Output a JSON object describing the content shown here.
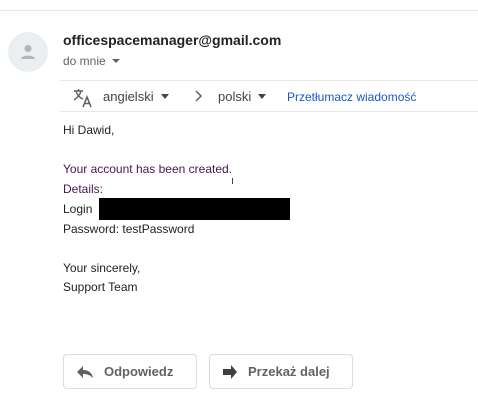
{
  "header": {
    "sender_email": "officespacemanager@gmail.com",
    "recipient_label": "do mnie"
  },
  "translate_bar": {
    "source_language": "angielski",
    "target_language": "polski",
    "translate_link": "Przetłumacz wiadomość"
  },
  "message": {
    "greeting": "Hi Dawid,",
    "created_line": "Your account has been created.",
    "details_label": "Details:",
    "login_label": "Login",
    "password_line": "Password: testPassword",
    "closing": "Your sincerely,",
    "signature": "Support Team"
  },
  "actions": {
    "reply_label": "Odpowiedz",
    "forward_label": "Przekaż dalej"
  },
  "icons": {
    "avatar": "person-icon",
    "translate": "translate-icon",
    "arrow": "chevron-right-icon",
    "reply": "reply-icon",
    "forward": "forward-icon"
  },
  "colors": {
    "link": "#1a58c8",
    "purple_text": "#4a1450",
    "muted": "#5f6368"
  }
}
